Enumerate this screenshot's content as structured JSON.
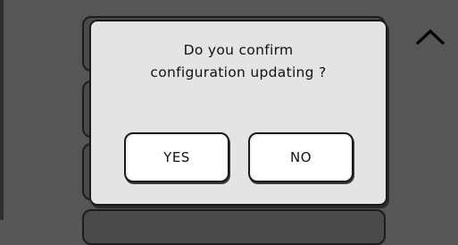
{
  "dialog": {
    "message_line1": "Do you confirm",
    "message_line2": "configuration updating ?",
    "yes_label": "YES",
    "no_label": "NO"
  },
  "navigation": {
    "scroll_up_icon": "chevron-up-icon"
  },
  "colors": {
    "screen_background": "#565656",
    "dialog_background": "#e4e4e4",
    "button_background": "#ffffff",
    "border": "#1a1a1a"
  }
}
